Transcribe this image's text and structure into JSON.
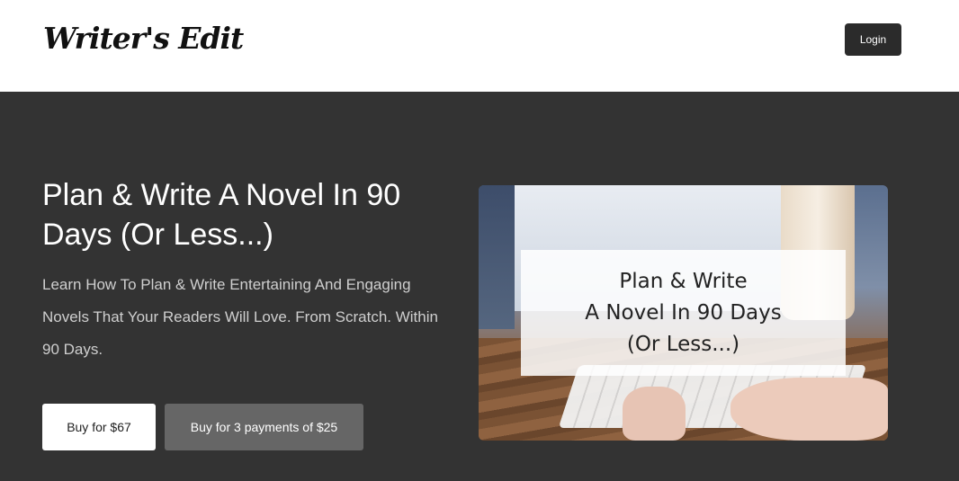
{
  "header": {
    "logo_text": "Writer's Edit",
    "login_label": "Login"
  },
  "hero": {
    "title": "Plan & Write A Novel In 90 Days (Or Less...)",
    "subtitle": "Learn How To Plan & Write Entertaining And Engaging Novels That Your Readers Will Love. From Scratch. Within 90 Days.",
    "buy_button": "Buy for $67",
    "payments_button": "Buy for 3 payments of $25"
  },
  "promo_image": {
    "line1": "Plan & Write",
    "line2": "A Novel In 90 Days",
    "line3": "(Or Less...)",
    "icon": "apple-logo-icon"
  },
  "colors": {
    "header_bg": "#ffffff",
    "hero_bg": "#333333",
    "login_bg": "#2b2b2b",
    "pay_button_bg": "#666666"
  }
}
